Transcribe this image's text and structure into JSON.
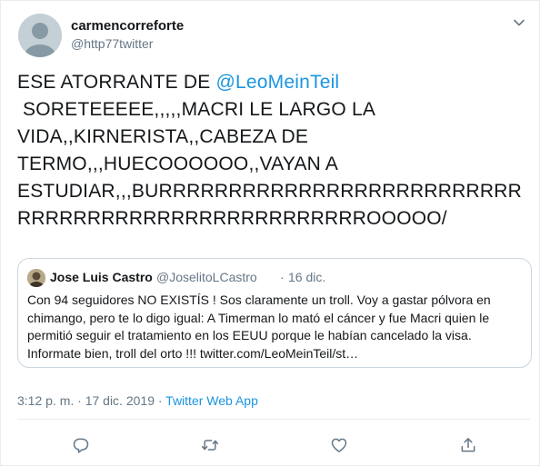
{
  "author": {
    "display_name": "carmencorreforte",
    "handle": "@http77twitter"
  },
  "tweet": {
    "text_before": "ESE ATORRANTE DE ",
    "mention": "@LeoMeinTeil",
    "text_after": "\n SORETEEEEE,,,,,MACRI LE LARGO LA VIDA,,KIRNERISTA,,CABEZA DE TERMO,,,HUECOOOOOO,,VAYAN A ESTUDIAR,,,BURRRRRRRRRRRRRRRRRRRRRRRRRRRRRRRRRRRRRRRRRRRRRRRRRRROOOOO/"
  },
  "quoted_tweet": {
    "display_name": "Jose Luis Castro",
    "handle": "@JoselitoLCastro",
    "separator": "·",
    "date": "16 dic.",
    "text": "Con 94 seguidores NO EXISTÍS ! Sos claramente un troll. Voy a gastar pólvora en chimango, pero te lo digo igual: A Timerman lo mató el cáncer y fue Macri quien le permitió seguir el tratamiento en los EEUU porque le habían cancelado la visa. Informate bien, troll del orto !!! twitter.com/LeoMeinTeil/st…"
  },
  "meta": {
    "time_date": "3:12 p. m. · 17 dic. 2019 · ",
    "source": "Twitter Web App"
  },
  "icons": {
    "caret": "chevron-down-icon",
    "reply": "reply-icon",
    "retweet": "retweet-icon",
    "like": "heart-icon",
    "share": "share-icon"
  },
  "colors": {
    "link": "#1b95e0",
    "secondary_text": "#657786",
    "icon": "#657786",
    "border": "#ccd6dd"
  }
}
